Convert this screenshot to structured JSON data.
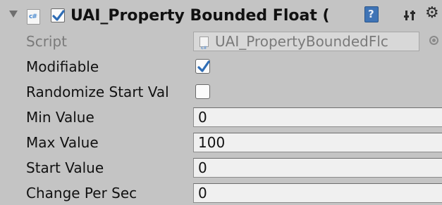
{
  "component": {
    "title": "UAI_Property Bounded Float (",
    "enabled": true,
    "icons": {
      "foldout": "foldout-expanded-triangle",
      "script": "csharp-script-icon",
      "help": "help-book-icon",
      "preset": "preset-sliders-icon",
      "settings": "gear-icon"
    }
  },
  "fields": {
    "script": {
      "label": "Script",
      "value": "UAI_PropertyBoundedFlc"
    },
    "modifiable": {
      "label": "Modifiable",
      "checked": true
    },
    "randomize_start": {
      "label": "Randomize Start Val",
      "checked": false
    },
    "min_value": {
      "label": "Min Value",
      "value": "0"
    },
    "max_value": {
      "label": "Max Value",
      "value": "100"
    },
    "start_value": {
      "label": "Start Value",
      "value": "0"
    },
    "change_per_sec": {
      "label": "Change Per Sec",
      "value": "0"
    }
  },
  "colors": {
    "panel_background": "#c4c4c4",
    "field_background": "#f0f0f0",
    "help_icon": "#3f74b6",
    "disabled_text": "#7a7a7a"
  }
}
